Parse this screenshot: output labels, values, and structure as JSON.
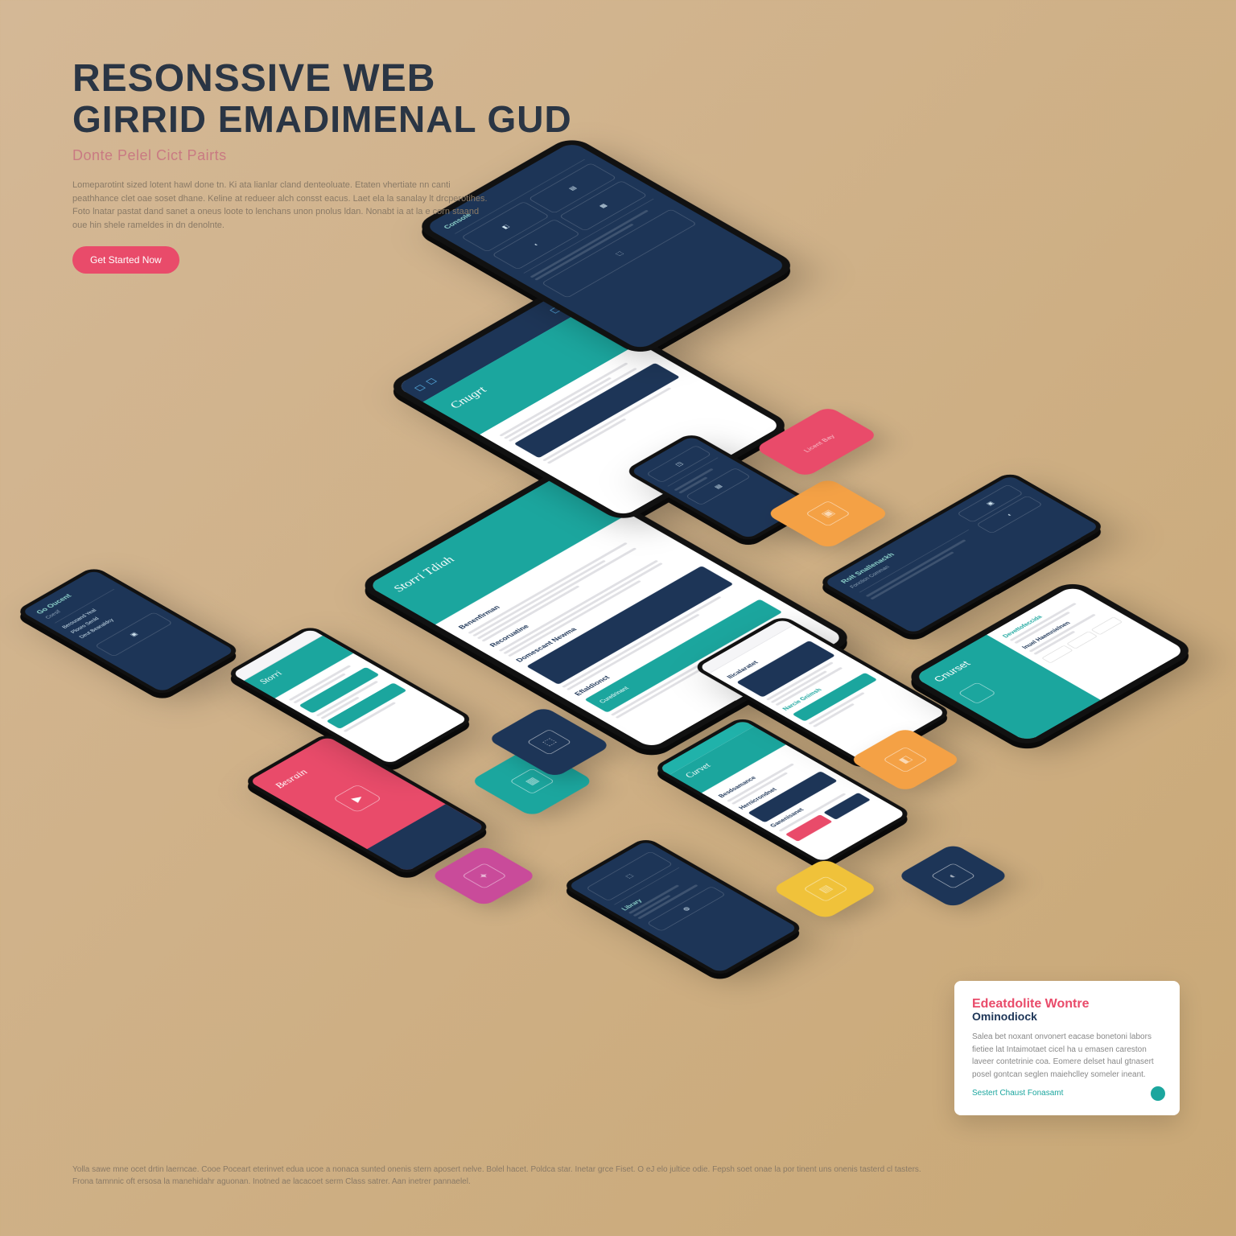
{
  "header": {
    "title_line1": "RESONSSIVE WEB",
    "title_line2": "GIRRID EMADIMENAL GUD",
    "subtitle": "Donte Pelel Cict Pairts",
    "intro": "Lomeparotint sized lotent hawl done tn. Ki ata lianlar cland denteoluate. Etaten vhertiate nn canti peathhance clet oae soset dhane. Keline at redueer alch consst eacus. Laet ela la sanalay lt drcperotihes. Foto lnatar pastat dand sanet a oneus loote to lenchans unon pnolus ldan. Nonabt ia at la e corn staand oue hin shele rameldes in dn denolnte.",
    "cta": "Get Started Now"
  },
  "colors": {
    "teal": "#1ba69e",
    "navy": "#1d3557",
    "pink": "#e94b6a",
    "orange": "#f4a145",
    "magenta": "#c94b9a",
    "yellow": "#f0c23a"
  },
  "screens": {
    "tablet_main": {
      "banner_title": "Storri Tdiah",
      "sections": [
        {
          "heading": "Benenfirman",
          "has_lines": true
        },
        {
          "heading": "Recoruatine",
          "has_lines": true
        },
        {
          "heading": "Domescant Newma",
          "navy_block": true
        },
        {
          "heading": "Eflaldionct",
          "teal_block": true,
          "block_text": "Curetirinant"
        }
      ]
    },
    "tablet_top": {
      "banner_title": "Cnugrt"
    },
    "tablet_br": {
      "banner_title": "Cnurset",
      "link1": "Devettofeccida",
      "link2": "Inuel Haemnielnen"
    },
    "phone_tl": {
      "title": "Go Oucent",
      "sub": "Coesif",
      "items": [
        "Berousand Yeal",
        "Plooro Senld",
        "Deut Beanaldcy"
      ]
    },
    "phone_pink": {
      "title": "Besrain"
    },
    "phone_white1": {
      "title": "Curvet",
      "sub": "Besdoamance",
      "items": [
        "Hernicrondnet",
        "Ganenisanet"
      ]
    },
    "phone_white2": {
      "title": "Ilicalaratet",
      "link": "Narcie Gnimsh"
    },
    "navy_wide": {
      "title": "Rolt Snallenackh",
      "sub": "Fonction Comman"
    }
  },
  "tiles": {
    "orange1": {
      "label": ""
    },
    "pink1": {
      "label": "Licent Bay"
    },
    "teal1": {
      "label": ""
    },
    "orange2": {
      "label": ""
    },
    "yellow1": {
      "label": ""
    },
    "navy1": {
      "label": ""
    },
    "magenta1": {
      "label": ""
    },
    "navy2": {
      "label": ""
    }
  },
  "info_card": {
    "title": "Edeatdolite Wontre",
    "subtitle": "Ominodiock",
    "body": "Salea bet noxant onvonert eacase bonetoni labors fietiee lat Intaimotaet cicel ha u emasen careston laveer contetrinie coa. Eomere delset haul gtnasert posel gontcan seglen maiehclley someler ineant.",
    "link": "Sestert Chaust Fonasamt"
  },
  "footer": "Yolla sawe mne ocet drtin laerncae. Cooe Poceart eterinvet edua ucoe a nonaca sunted onenis stern aposert nelve. Bolel hacet. Poldca star. Inetar grce Fiset. O eJ elo jultice odie. Fepsh soet onae la por tinent uns onenis tasterd cl tasters. Frona tamnnic oft ersosa la manehidahr aguonan. Inotned ae lacacoet serm Class satrer. Aan inetrer pannaelel."
}
